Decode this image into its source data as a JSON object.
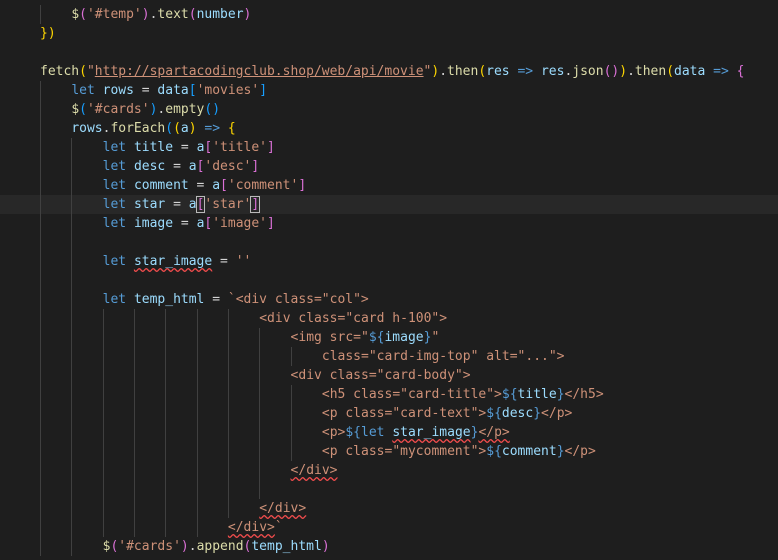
{
  "theme": {
    "background": "#1e1e1e",
    "default": "#d4d4d4",
    "keyword": "#569cd6",
    "variable": "#9cdcfe",
    "function": "#dcdcaa",
    "string": "#ce9178",
    "tag": "#569cd6",
    "bracket_gold": "#ffd700",
    "bracket_pink": "#da70d6",
    "bracket_blue": "#179fff",
    "plain": "#d4d4d4"
  },
  "lines": [
    {
      "indent": 1,
      "tokens": [
        [
          "$",
          "function"
        ],
        [
          "(",
          "bracket_pink"
        ],
        [
          "'#temp'",
          "string"
        ],
        [
          ")",
          "bracket_pink"
        ],
        [
          ".",
          "default"
        ],
        [
          "text",
          "function"
        ],
        [
          "(",
          "bracket_pink"
        ],
        [
          "number",
          "variable"
        ],
        [
          ")",
          "bracket_pink"
        ]
      ]
    },
    {
      "indent": 0,
      "tokens": [
        [
          "})",
          "bracket_gold"
        ]
      ]
    },
    {
      "indent": 0,
      "tokens": []
    },
    {
      "indent": 0,
      "tokens": [
        [
          "fetch",
          "function"
        ],
        [
          "(",
          "bracket_gold"
        ],
        [
          "\"",
          "string"
        ],
        [
          "http://spartacodingclub.shop/web/api/movie",
          "string",
          "url"
        ],
        [
          "\"",
          "string"
        ],
        [
          ")",
          "bracket_gold"
        ],
        [
          ".",
          "default"
        ],
        [
          "then",
          "function"
        ],
        [
          "(",
          "bracket_gold"
        ],
        [
          "res",
          "variable"
        ],
        [
          " => ",
          "keyword"
        ],
        [
          "res",
          "variable"
        ],
        [
          ".",
          "default"
        ],
        [
          "json",
          "function"
        ],
        [
          "()",
          "bracket_pink"
        ],
        [
          ")",
          "bracket_gold"
        ],
        [
          ".",
          "default"
        ],
        [
          "then",
          "function"
        ],
        [
          "(",
          "bracket_gold"
        ],
        [
          "data",
          "variable"
        ],
        [
          " => ",
          "keyword"
        ],
        [
          "{",
          "bracket_pink"
        ]
      ]
    },
    {
      "indent": 1,
      "tokens": [
        [
          "let ",
          "keyword"
        ],
        [
          "rows",
          "variable"
        ],
        [
          " = ",
          "default"
        ],
        [
          "data",
          "variable"
        ],
        [
          "[",
          "bracket_blue"
        ],
        [
          "'movies'",
          "string"
        ],
        [
          "]",
          "bracket_blue"
        ]
      ]
    },
    {
      "indent": 1,
      "tokens": [
        [
          "$",
          "function"
        ],
        [
          "(",
          "bracket_blue"
        ],
        [
          "'#cards'",
          "string"
        ],
        [
          ")",
          "bracket_blue"
        ],
        [
          ".",
          "default"
        ],
        [
          "empty",
          "function"
        ],
        [
          "()",
          "bracket_blue"
        ]
      ]
    },
    {
      "indent": 1,
      "tokens": [
        [
          "rows",
          "variable"
        ],
        [
          ".",
          "default"
        ],
        [
          "forEach",
          "function"
        ],
        [
          "(",
          "bracket_blue"
        ],
        [
          "(",
          "bracket_gold"
        ],
        [
          "a",
          "variable"
        ],
        [
          ")",
          "bracket_gold"
        ],
        [
          " => ",
          "keyword"
        ],
        [
          "{",
          "bracket_gold"
        ]
      ]
    },
    {
      "indent": 2,
      "tokens": [
        [
          "let ",
          "keyword"
        ],
        [
          "title",
          "variable"
        ],
        [
          " = ",
          "default"
        ],
        [
          "a",
          "variable"
        ],
        [
          "[",
          "bracket_pink"
        ],
        [
          "'title'",
          "string"
        ],
        [
          "]",
          "bracket_pink"
        ]
      ]
    },
    {
      "indent": 2,
      "tokens": [
        [
          "let ",
          "keyword"
        ],
        [
          "desc",
          "variable"
        ],
        [
          " = ",
          "default"
        ],
        [
          "a",
          "variable"
        ],
        [
          "[",
          "bracket_pink"
        ],
        [
          "'desc'",
          "string"
        ],
        [
          "]",
          "bracket_pink"
        ]
      ]
    },
    {
      "indent": 2,
      "tokens": [
        [
          "let ",
          "keyword"
        ],
        [
          "comment",
          "variable"
        ],
        [
          " = ",
          "default"
        ],
        [
          "a",
          "variable"
        ],
        [
          "[",
          "bracket_pink"
        ],
        [
          "'comment'",
          "string"
        ],
        [
          "]",
          "bracket_pink"
        ]
      ]
    },
    {
      "indent": 2,
      "current": true,
      "tokens": [
        [
          "let ",
          "keyword"
        ],
        [
          "star",
          "variable"
        ],
        [
          " = ",
          "default"
        ],
        [
          "a",
          "variable"
        ],
        [
          "[",
          "bracket_pink",
          "cursor"
        ],
        [
          "'star'",
          "string"
        ],
        [
          "]",
          "bracket_pink",
          "cursor"
        ]
      ]
    },
    {
      "indent": 2,
      "tokens": [
        [
          "let ",
          "keyword"
        ],
        [
          "image",
          "variable"
        ],
        [
          " = ",
          "default"
        ],
        [
          "a",
          "variable"
        ],
        [
          "[",
          "bracket_pink"
        ],
        [
          "'image'",
          "string"
        ],
        [
          "]",
          "bracket_pink"
        ]
      ]
    },
    {
      "indent": 2,
      "tokens": []
    },
    {
      "indent": 2,
      "tokens": [
        [
          "let ",
          "keyword"
        ],
        [
          "star_image",
          "variable",
          "err"
        ],
        [
          " = ",
          "default"
        ],
        [
          "''",
          "string"
        ]
      ]
    },
    {
      "indent": 2,
      "tokens": []
    },
    {
      "indent": 2,
      "tokens": [
        [
          "let ",
          "keyword"
        ],
        [
          "temp_html",
          "variable"
        ],
        [
          " = ",
          "default"
        ],
        [
          "`<div class=\"col\">",
          "string"
        ]
      ]
    },
    {
      "indent": 7,
      "tokens": [
        [
          "<div class=\"card h-100\">",
          "string"
        ]
      ]
    },
    {
      "indent": 8,
      "tokens": [
        [
          "<img src=\"",
          "string"
        ],
        [
          "${",
          "keyword"
        ],
        [
          "image",
          "variable"
        ],
        [
          "}",
          "keyword"
        ],
        [
          "\"",
          "string"
        ]
      ]
    },
    {
      "indent": 9,
      "tokens": [
        [
          "class=\"card-img-top\" alt=\"...\">",
          "string"
        ]
      ]
    },
    {
      "indent": 8,
      "tokens": [
        [
          "<div class=\"card-body\">",
          "string"
        ]
      ]
    },
    {
      "indent": 9,
      "tokens": [
        [
          "<h5 class=\"card-title\">",
          "string"
        ],
        [
          "${",
          "keyword"
        ],
        [
          "title",
          "variable"
        ],
        [
          "}",
          "keyword"
        ],
        [
          "</h5>",
          "string"
        ]
      ]
    },
    {
      "indent": 9,
      "tokens": [
        [
          "<p class=\"card-text\">",
          "string"
        ],
        [
          "${",
          "keyword"
        ],
        [
          "desc",
          "variable"
        ],
        [
          "}",
          "keyword"
        ],
        [
          "</p>",
          "string"
        ]
      ]
    },
    {
      "indent": 9,
      "tokens": [
        [
          "<p>",
          "string"
        ],
        [
          "${",
          "keyword"
        ],
        [
          "let ",
          "keyword"
        ],
        [
          "star_image",
          "variable",
          "err"
        ],
        [
          "}",
          "keyword"
        ],
        [
          "</p>",
          "string",
          "err"
        ]
      ]
    },
    {
      "indent": 9,
      "tokens": [
        [
          "<p class=\"mycomment\">",
          "string"
        ],
        [
          "${",
          "keyword"
        ],
        [
          "comment",
          "variable"
        ],
        [
          "}",
          "keyword"
        ],
        [
          "</p>",
          "string"
        ]
      ]
    },
    {
      "indent": 8,
      "tokens": [
        [
          "</div>",
          "string",
          "err"
        ]
      ]
    },
    {
      "indent": 8,
      "tokens": []
    },
    {
      "indent": 7,
      "tokens": [
        [
          "</div>",
          "string",
          "err"
        ]
      ]
    },
    {
      "indent": 6,
      "tokens": [
        [
          "</div>",
          "string",
          "err"
        ],
        [
          "`",
          "string"
        ]
      ]
    },
    {
      "indent": 2,
      "tokens": [
        [
          "$",
          "function"
        ],
        [
          "(",
          "bracket_pink"
        ],
        [
          "'#cards'",
          "string"
        ],
        [
          ")",
          "bracket_pink"
        ],
        [
          ".",
          "default"
        ],
        [
          "append",
          "function"
        ],
        [
          "(",
          "bracket_pink"
        ],
        [
          "temp_html",
          "variable"
        ],
        [
          ")",
          "bracket_pink"
        ]
      ]
    }
  ]
}
